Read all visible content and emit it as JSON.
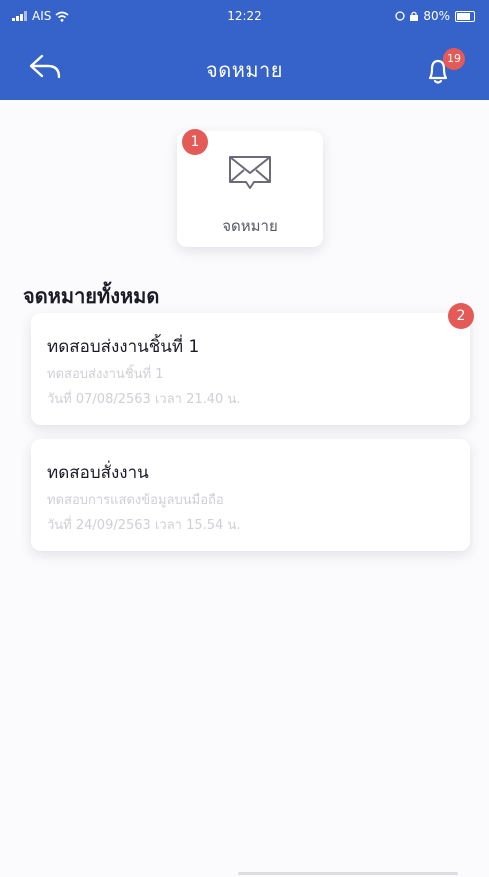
{
  "status_bar": {
    "carrier": "AIS",
    "time": "12:22",
    "battery": "80%"
  },
  "header": {
    "title": "จดหมาย",
    "notification_count": "19"
  },
  "mail_tile": {
    "label": "จดหมาย",
    "badge": "1"
  },
  "list": {
    "title": "จดหมายทั้งหมด",
    "badge": "2",
    "items": [
      {
        "title": "ทดสอบส่งงานชิ้นที่ 1",
        "subtitle": "ทดสอบส่งงานชิ้นที่ 1",
        "date": "วันที่ 07/08/2563 เวลา 21.40 น."
      },
      {
        "title": "ทดสอบสั่งงาน",
        "subtitle": "ทดสอบการแสดงข้อมูลบนมือถือ",
        "date": "วันที่ 24/09/2563 เวลา 15.54 น."
      }
    ]
  },
  "colors": {
    "header_bg": "#3563c9",
    "badge": "#e45a57"
  }
}
